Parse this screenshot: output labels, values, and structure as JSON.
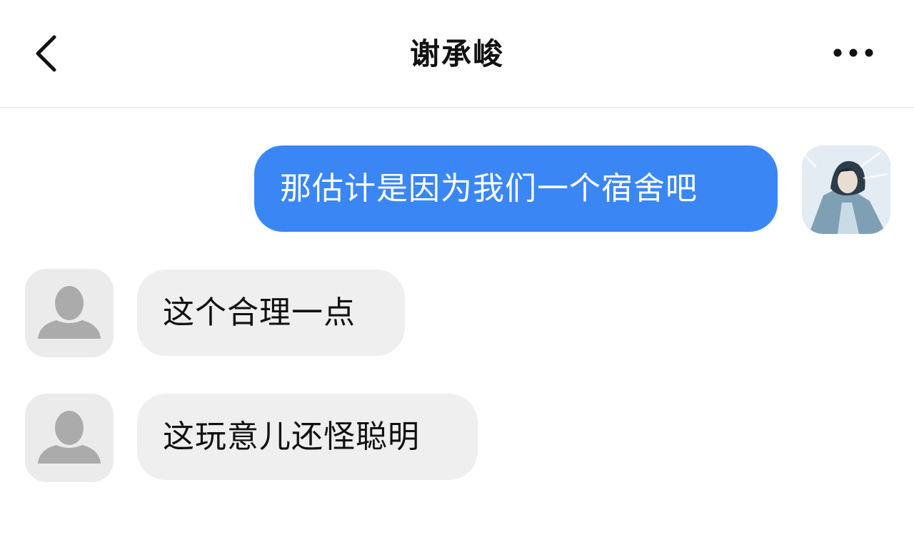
{
  "header": {
    "title": "谢承峻",
    "back_icon": "chevron-left-icon",
    "more_icon": "more-horizontal-icon"
  },
  "messages": [
    {
      "direction": "outgoing",
      "text": "那估计是因为我们一个宿舍吧",
      "avatar": "user-photo-avatar"
    },
    {
      "direction": "incoming",
      "text": "这个合理一点",
      "avatar": "default-person-avatar"
    },
    {
      "direction": "incoming",
      "text": "这玩意儿还怪聪明",
      "avatar": "default-person-avatar"
    }
  ],
  "colors": {
    "outgoing_bubble": "#3a86f5",
    "incoming_bubble": "#efefef",
    "text_dark": "#111111",
    "divider": "#e6e6e6"
  }
}
